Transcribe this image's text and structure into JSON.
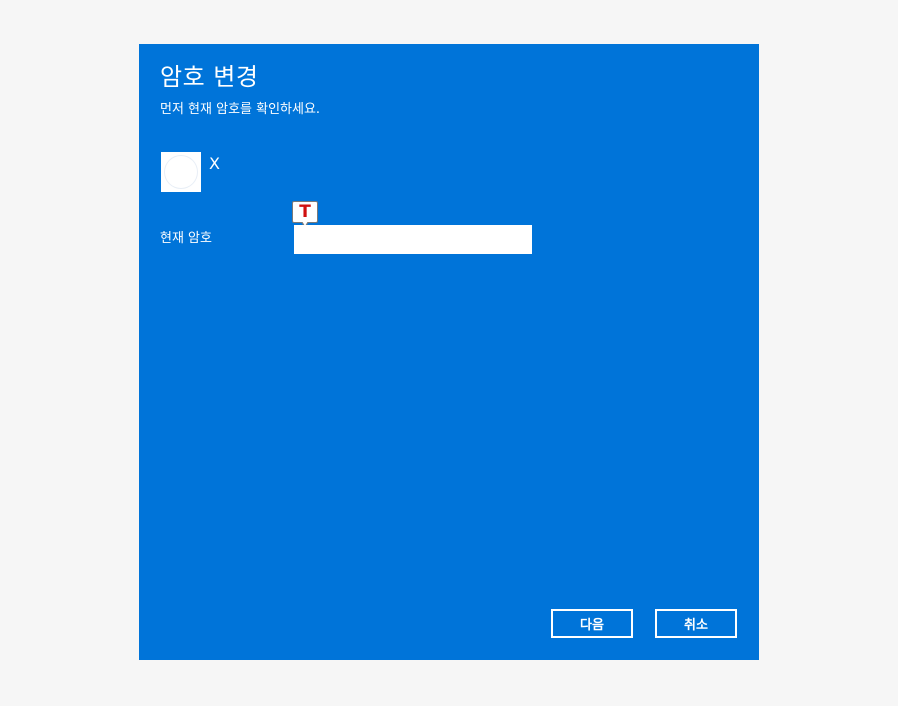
{
  "dialog": {
    "title": "암호 변경",
    "subtitle": "먼저 현재 암호를 확인하세요.",
    "background_color": "#0074d9"
  },
  "account": {
    "avatar_icon": "user-avatar",
    "username": "X"
  },
  "form": {
    "current_password_label": "현재 암호",
    "current_password_value": "",
    "ime_indicator_icon": "ime-mode-icon",
    "ime_indicator_glyph": "T",
    "ime_indicator_color": "#d01010"
  },
  "buttons": {
    "next_label": "다음",
    "cancel_label": "취소"
  }
}
